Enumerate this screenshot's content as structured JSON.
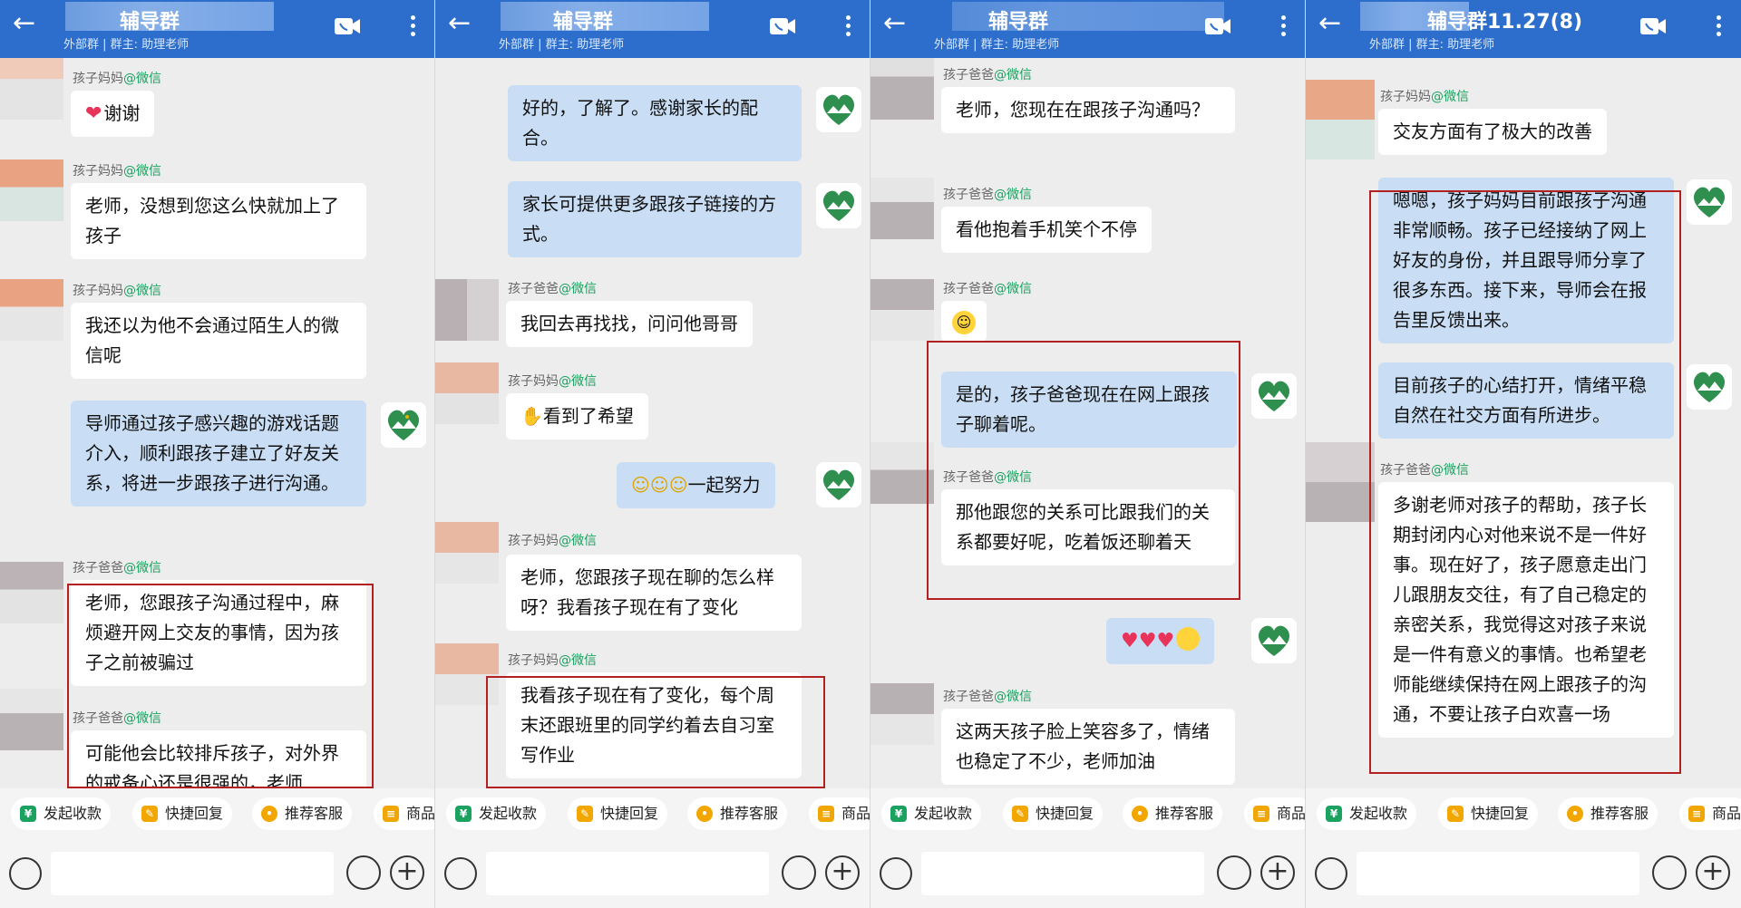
{
  "colors": {
    "header": "#2d6ecc",
    "bubble_self": "#c9def5",
    "wechat_tag": "#1aa260",
    "highlight": "#b22020"
  },
  "header": {
    "external_label": "外部群",
    "owner_label": "群主: 助理老师"
  },
  "sender_names": {
    "mom": "孩子妈妈",
    "dad": "孩子爸爸",
    "wx": "@微信"
  },
  "toolbar": {
    "collect": "发起收款",
    "quick_reply": "快捷回复",
    "recommend": "推荐客服",
    "product": "商品"
  },
  "panels": [
    {
      "title": "辅导群",
      "messages": [
        {
          "text": "谢谢"
        },
        {
          "text": "老师，没想到您这么快就加上了孩子"
        },
        {
          "text": "我还以为他不会通过陌生人的微信呢"
        },
        {
          "text": "导师通过孩子感兴趣的游戏话题介入，顺利跟孩子建立了好友关系，将进一步跟孩子进行沟通。"
        },
        {
          "text": "老师，您跟孩子沟通过程中，麻烦避开网上交友的事情，因为孩子之前被骗过"
        },
        {
          "text": "可能他会比较排斥孩子，对外界的戒备心还是很强的，老师"
        }
      ]
    },
    {
      "title": "辅导群",
      "messages": [
        {
          "text": "好的，了解了。感谢家长的配合。"
        },
        {
          "text": "家长可提供更多跟孩子链接的方式。"
        },
        {
          "text": "我回去再找找，问问他哥哥"
        },
        {
          "text": "看到了希望"
        },
        {
          "text": "一起努力"
        },
        {
          "text": "老师，您跟孩子现在聊的怎么样呀？我看孩子现在有了变化"
        },
        {
          "text": "我看孩子现在有了变化，每个周末还跟班里的同学约着去自习室写作业"
        }
      ]
    },
    {
      "title": "辅导群",
      "messages": [
        {
          "text": "老师，您现在在跟孩子沟通吗？"
        },
        {
          "text": "看他抱着手机笑个不停"
        },
        {
          "text": "是的，孩子爸爸现在在网上跟孩子聊着呢。"
        },
        {
          "text": "那他跟您的关系可比跟我们的关系都要好呢，吃着饭还聊着天"
        },
        {
          "text": "这两天孩子脸上笑容多了，情绪也稳定了不少，老师加油"
        }
      ]
    },
    {
      "title": "辅导群11.27(8)",
      "messages": [
        {
          "text": "交友方面有了极大的改善"
        },
        {
          "text": "嗯嗯，孩子妈妈目前跟孩子沟通非常顺畅。孩子已经接纳了网上好友的身份，并且跟导师分享了很多东西。接下来，导师会在报告里反馈出来。"
        },
        {
          "text": "目前孩子的心结打开，情绪平稳自然在社交方面有所进步。"
        },
        {
          "text": "多谢老师对孩子的帮助，孩子长期封闭内心对他来说不是一件好事。现在好了，孩子愿意走出门儿跟朋友交往，有了自己稳定的亲密关系，我觉得这对孩子来说是一件有意义的事情。也希望老师能继续保持在网上跟孩子的沟通，不要让孩子白欢喜一场"
        }
      ]
    }
  ]
}
